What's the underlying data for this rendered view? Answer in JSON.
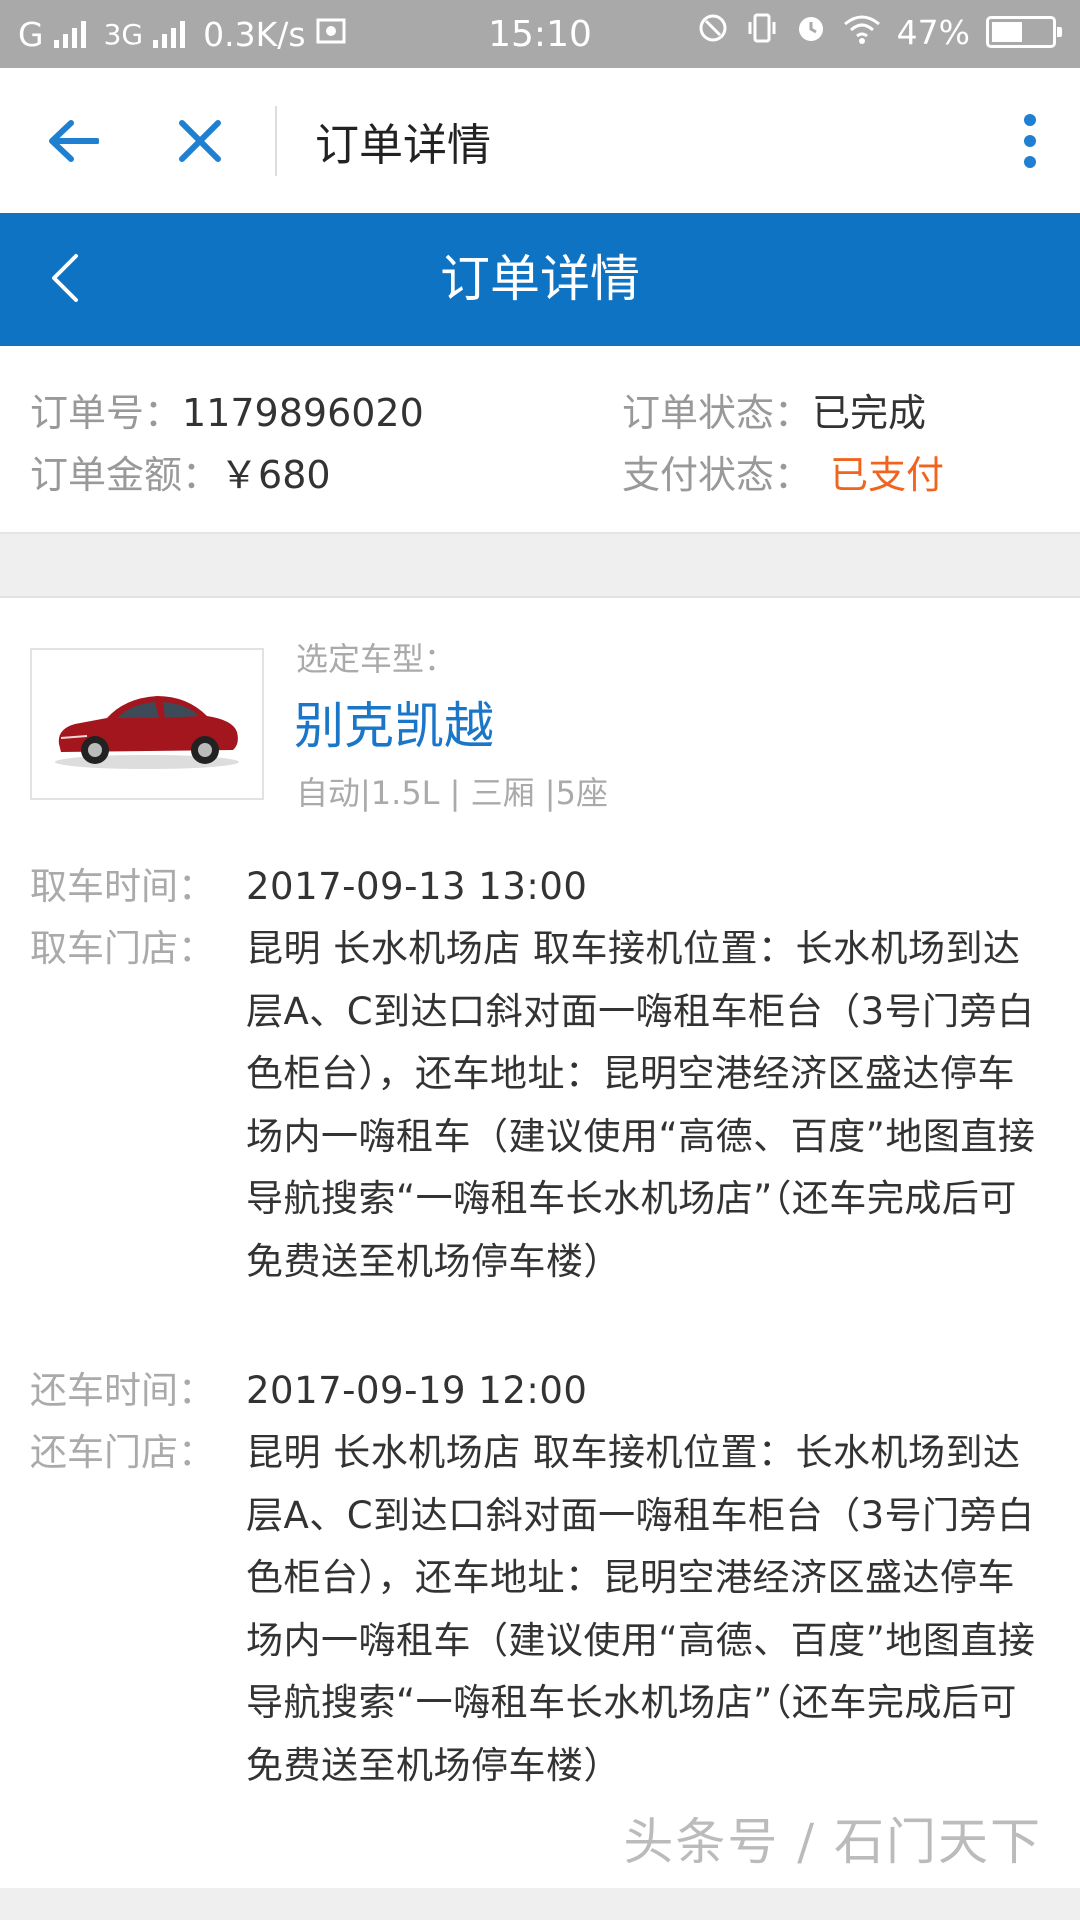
{
  "status_bar": {
    "carrier1": "G",
    "carrier2": "3G",
    "net_speed": "0.3K/s",
    "time": "15:10",
    "battery": "47%"
  },
  "browser_bar": {
    "title": "订单详情"
  },
  "app_bar": {
    "title": "订单详情"
  },
  "summary": {
    "order_no_label": "订单号：",
    "order_no": "1179896020",
    "amount_label": "订单金额：",
    "amount": "￥680",
    "order_status_label": "订单状态：",
    "order_status": "已完成",
    "pay_status_label": "支付状态：",
    "pay_status": "已支付"
  },
  "car": {
    "caption": "选定车型：",
    "name": "别克凯越",
    "spec": "自动|1.5L | 三厢 |5座"
  },
  "details": {
    "pickup_time_label": "取车时间：",
    "pickup_time": "2017-09-13 13:00",
    "pickup_store_label": "取车门店：",
    "pickup_store": "昆明 长水机场店 取车接机位置：长水机场到达层A、C到达口斜对面一嗨租车柜台（3号门旁白色柜台），还车地址：昆明空港经济区盛达停车场内一嗨租车（建议使用“高德、百度”地图直接导航搜索“一嗨租车长水机场店”（还车完成后可免费送至机场停车楼）",
    "return_time_label": "还车时间：",
    "return_time": "2017-09-19 12:00",
    "return_store_label": "还车门店：",
    "return_store": "昆明 长水机场店 取车接机位置：长水机场到达层A、C到达口斜对面一嗨租车柜台（3号门旁白色柜台），还车地址：昆明空港经济区盛达停车场内一嗨租车（建议使用“高德、百度”地图直接导航搜索“一嗨租车长水机场店”（还车完成后可免费送至机场停车楼）"
  },
  "watermark": "头条号 / 石门天下",
  "colors": {
    "app_bar": "#0f73c3",
    "accent_blue": "#1976c8",
    "paid_orange": "#f1641e"
  }
}
